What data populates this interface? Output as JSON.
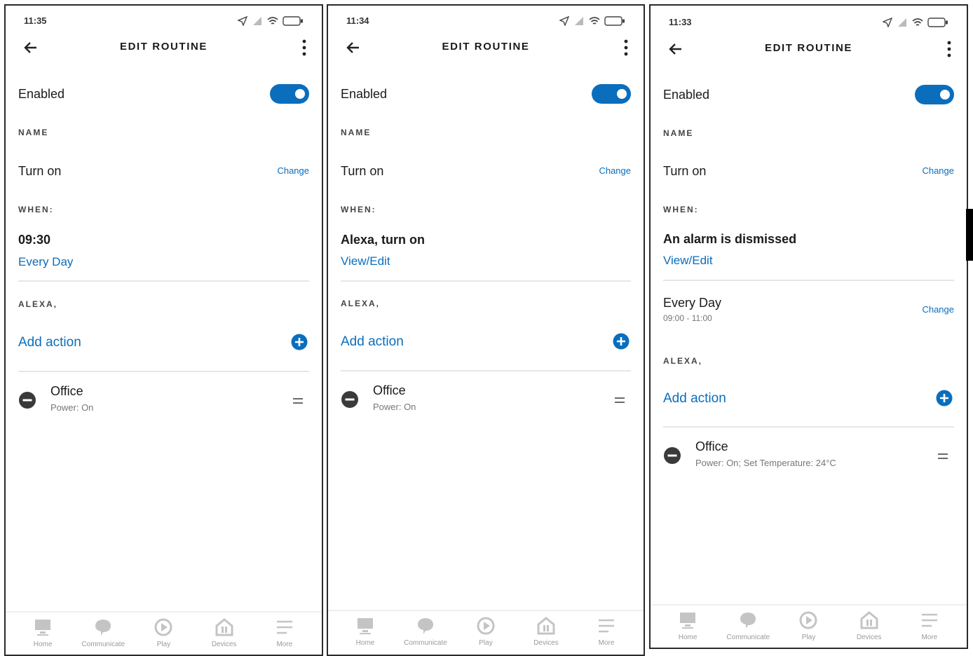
{
  "screens": [
    {
      "status_time": "11:35",
      "title": "EDIT ROUTINE",
      "enabled_label": "Enabled",
      "name_section": "NAME",
      "routine_name": "Turn on",
      "change_label": "Change",
      "when_section": "WHEN:",
      "trigger": "09:30",
      "trigger_link": "Every Day",
      "alexa_section": "ALEXA,",
      "add_action": "Add action",
      "action_title": "Office",
      "action_detail": "Power: On"
    },
    {
      "status_time": "11:34",
      "title": "EDIT ROUTINE",
      "enabled_label": "Enabled",
      "name_section": "NAME",
      "routine_name": "Turn on",
      "change_label": "Change",
      "when_section": "WHEN:",
      "trigger": "Alexa, turn on",
      "trigger_link": "View/Edit",
      "alexa_section": "ALEXA,",
      "add_action": "Add action",
      "action_title": "Office",
      "action_detail": "Power: On"
    },
    {
      "status_time": "11:33",
      "title": "EDIT ROUTINE",
      "enabled_label": "Enabled",
      "name_section": "NAME",
      "routine_name": "Turn on",
      "change_label": "Change",
      "when_section": "WHEN:",
      "trigger": "An alarm is dismissed",
      "trigger_link": "View/Edit",
      "schedule_title": "Every Day",
      "schedule_time": "09:00 - 11:00",
      "schedule_change": "Change",
      "alexa_section": "ALEXA,",
      "add_action": "Add action",
      "action_title": "Office",
      "action_detail": "Power: On; Set Temperature: 24°C"
    }
  ],
  "bottom_nav": [
    "Home",
    "Communicate",
    "Play",
    "Devices",
    "More"
  ],
  "colors": {
    "accent": "#0a6ebd",
    "text": "#1a1a1a",
    "muted": "#777777",
    "divider": "#e6e6e6"
  }
}
